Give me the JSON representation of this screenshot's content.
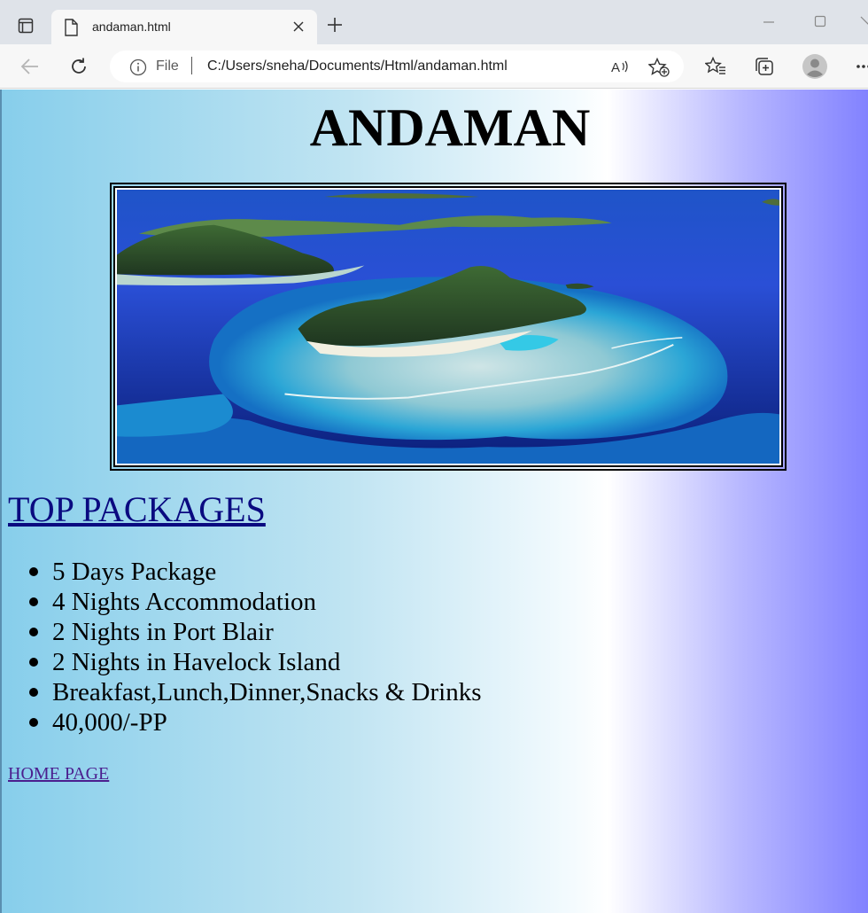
{
  "browser": {
    "tab_title": "andaman.html",
    "address_scheme_label": "File",
    "address_url": "C:/Users/sneha/Documents/Html/andaman.html"
  },
  "page": {
    "heading": "ANDAMAN",
    "image_subject": "aerial view of a tropical island surrounded by coral reef",
    "packages_title": "TOP PACKAGES",
    "packages": [
      "5 Days Package",
      "4 Nights Accommodation",
      "2 Nights in Port Blair",
      "2 Nights in Havelock Island",
      "Breakfast,Lunch,Dinner,Snacks & Drinks",
      "40,000/-PP"
    ],
    "home_link": "HOME PAGE"
  },
  "colors": {
    "gradient_start": "#87ceeb",
    "gradient_middle": "#ffffff",
    "gradient_end": "#8282ff",
    "link_title": "#0a0a80",
    "link_visited": "#4b1e8e"
  }
}
